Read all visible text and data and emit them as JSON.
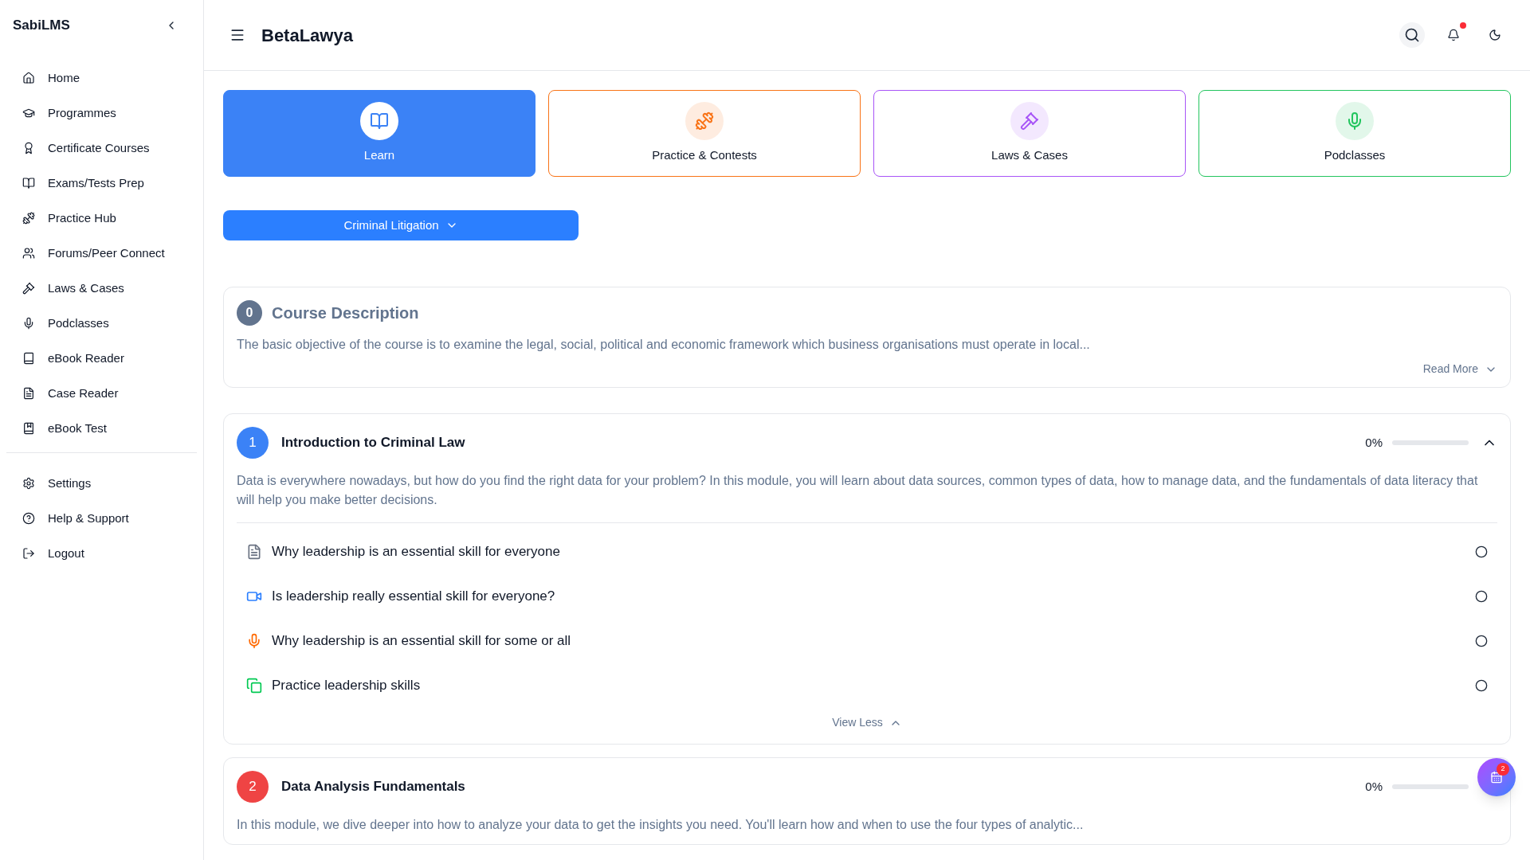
{
  "sidebar": {
    "brand": "SabiLMS",
    "items": [
      {
        "label": "Home"
      },
      {
        "label": "Programmes"
      },
      {
        "label": "Certificate Courses"
      },
      {
        "label": "Exams/Tests Prep"
      },
      {
        "label": "Practice Hub"
      },
      {
        "label": "Forums/Peer Connect"
      },
      {
        "label": "Laws & Cases"
      },
      {
        "label": "Podclasses"
      },
      {
        "label": "eBook Reader"
      },
      {
        "label": "Case Reader"
      },
      {
        "label": "eBook Test"
      }
    ],
    "bottom_items": [
      {
        "label": "Settings"
      },
      {
        "label": "Help & Support"
      },
      {
        "label": "Logout"
      }
    ]
  },
  "header": {
    "title": "BetaLawya",
    "has_notification": true
  },
  "nav_cards": [
    {
      "label": "Learn",
      "selected": true,
      "color": "#3b82f6"
    },
    {
      "label": "Practice & Contests",
      "selected": false,
      "color": "#f97316"
    },
    {
      "label": "Laws & Cases",
      "selected": false,
      "color": "#a855f7"
    },
    {
      "label": "Podclasses",
      "selected": false,
      "color": "#22c55e"
    }
  ],
  "course_select": {
    "value": "Criminal Litigation"
  },
  "course_description": {
    "number": "0",
    "title": "Course Description",
    "text": "The basic objective of the course is to examine the legal, social, political and economic framework which business organisations must operate in local...",
    "toggle": "Read More"
  },
  "modules": [
    {
      "number": "1",
      "color": "#3b82f6",
      "title": "Introduction to Criminal Law",
      "progress": "0%",
      "expanded": true,
      "description": "Data is everywhere nowadays, but how do you find the right data for your problem? In this module, you will learn about data sources, common types of data, how to manage data, and the fundamentals of data literacy that will help you make better decisions.",
      "lessons": [
        {
          "kind": "document",
          "title": "Why leadership is an essential skill for everyone",
          "completed": false
        },
        {
          "kind": "video",
          "title": "Is leadership really essential skill for everyone?",
          "completed": false
        },
        {
          "kind": "audio",
          "title": "Why leadership is an essential skill for some or all",
          "completed": false
        },
        {
          "kind": "practice",
          "title": "Practice leadership skills",
          "completed": false
        }
      ],
      "toggle": "View Less"
    },
    {
      "number": "2",
      "color": "#ef4444",
      "title": "Data Analysis Fundamentals",
      "progress": "0%",
      "expanded": false,
      "description": "In this module, we dive deeper into how to analyze your data to get the insights you need. You'll learn how and when to use the four types of analytic..."
    }
  ],
  "floating_button": {
    "badge": "2"
  }
}
